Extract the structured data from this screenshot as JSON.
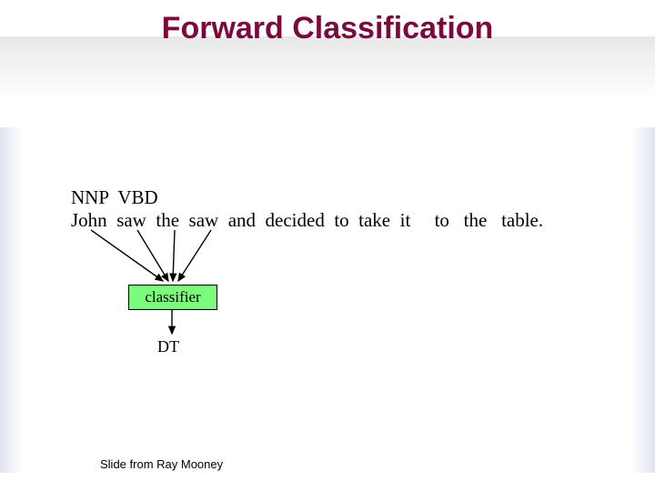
{
  "title": "Forward Classification",
  "tags": {
    "t0": "NNP",
    "t1": "VBD"
  },
  "sentence": {
    "w0": "John",
    "w1": "saw",
    "w2": "the",
    "w3": "saw",
    "w4": "and",
    "w5": "decided",
    "w6": "to",
    "w7": "take",
    "w8": "it",
    "w9": "to",
    "w10": "the",
    "w11": "table."
  },
  "classifier_label": "classifier",
  "output_tag": "DT",
  "credit": "Slide from Ray Mooney"
}
